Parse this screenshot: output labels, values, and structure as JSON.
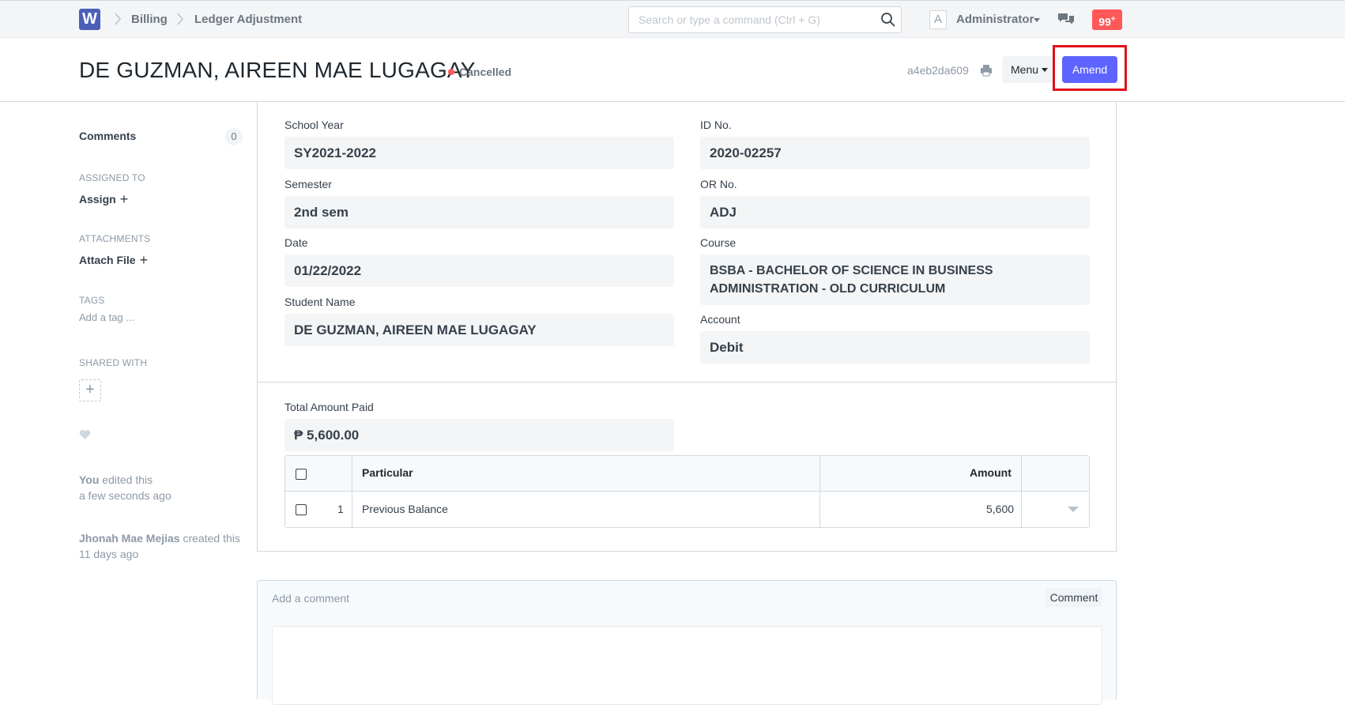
{
  "navbar": {
    "logo_letter": "W",
    "breadcrumbs": [
      "Billing",
      "Ledger Adjustment"
    ],
    "search_placeholder": "Search or type a command (Ctrl + G)",
    "avatar_letter": "A",
    "user_name": "Administrator",
    "notification_count": "99",
    "notification_suffix": "+"
  },
  "header": {
    "title": "DE GUZMAN, AIREEN MAE LUGAGAY",
    "status": "Cancelled",
    "status_color": "#ff5858",
    "doc_name": "a4eb2da609",
    "menu_label": "Menu",
    "amend_label": "Amend",
    "accent_color": "#5e64ff"
  },
  "sidebar": {
    "comments_label": "Comments",
    "comments_count": "0",
    "assigned_label": "ASSIGNED TO",
    "assign_action": "Assign",
    "attachments_label": "ATTACHMENTS",
    "attach_action": "Attach File",
    "tags_label": "TAGS",
    "tag_placeholder": "Add a tag ...",
    "shared_label": "SHARED WITH",
    "timeline": [
      {
        "actor": "You",
        "action": " edited this",
        "when": "a few seconds ago"
      },
      {
        "actor": "Jhonah Mae Mejias",
        "action": " created this",
        "when": "11 days ago"
      }
    ]
  },
  "form": {
    "left": [
      {
        "label": "School Year",
        "value": "SY2021-2022"
      },
      {
        "label": "Semester",
        "value": "2nd sem"
      },
      {
        "label": "Date",
        "value": "01/22/2022"
      },
      {
        "label": "Student Name",
        "value": "DE GUZMAN, AIREEN MAE LUGAGAY"
      }
    ],
    "right": [
      {
        "label": "ID No.",
        "value": "2020-02257"
      },
      {
        "label": "OR No.",
        "value": "ADJ"
      },
      {
        "label": "Course",
        "value": "BSBA - BACHELOR OF SCIENCE IN BUSINESS ADMINISTRATION - OLD CURRICULUM"
      },
      {
        "label": "Account",
        "value": "Debit"
      }
    ],
    "total_label": "Total Amount Paid",
    "total_value": "₱ 5,600.00"
  },
  "table": {
    "columns": [
      "Particular",
      "Amount"
    ],
    "rows": [
      {
        "idx": "1",
        "particular": "Previous Balance",
        "amount": "5,600"
      }
    ]
  },
  "comment": {
    "placeholder": "Add a comment",
    "button_label": "Comment"
  }
}
